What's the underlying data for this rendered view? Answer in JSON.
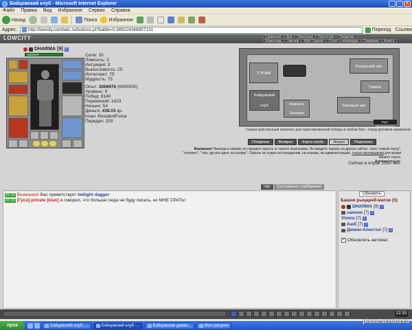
{
  "window": {
    "title": "Бойцовский клуб - Microsoft Internet Explorer"
  },
  "menu": {
    "items": [
      "Файл",
      "Правка",
      "Вид",
      "Избранное",
      "Сервис",
      "Справка"
    ]
  },
  "toolbar": {
    "back_label": "Назад",
    "search_label": "Поиск",
    "favorites_label": "Избранное"
  },
  "address": {
    "label": "Адрес:",
    "url": "http://lowcity.combats.ru/buttons.pl?battle=0.349224348857131",
    "go_label": "Переход",
    "links_label": "Ссылки"
  },
  "game": {
    "logo": "LOWCITY",
    "topnav_row1": [
      "Сражения",
      "Бои",
      "Персонаж",
      "Персонаж",
      "Поединки"
    ],
    "topnav_row2": [
      "Инвентарь",
      "Умения",
      "Мой Серилл",
      "Отчет о переводах",
      "Поединки",
      "Анкета"
    ],
    "character": {
      "name": "DHARMA",
      "level": "[9]",
      "hp": "221/221"
    },
    "stats": {
      "lines": [
        "Сила: 10",
        "Ловкость: 3",
        "Интуиция: 3",
        "Выносливость: 25",
        "Интеллект: 75",
        "Мудрость: 75"
      ]
    },
    "stats2": {
      "exp_label": "Опыт:",
      "exp_value": "3066976",
      "exp_next": "(6000000)",
      "lines": [
        "Уровень: 9",
        "Побед: 8140",
        "Поражений: 1423",
        "Ничьих: 54"
      ],
      "money_label": "Деньги:",
      "money_value": "438.03",
      "money_unit": "кр.",
      "clan": "Клан: ResidentForce",
      "transfers": "Передач: 200"
    },
    "map": {
      "rooms": [
        "3 ЭТАЖ",
        "Рыцарский зал",
        "Комната Знахаря",
        "Бойцовский клуб",
        "Торговый зал",
        "Тамень"
      ],
      "counter": "порт-#0576720521",
      "caption": "Самый действенный комплект для гарантированной победы в любом бою - отряд артников наемников"
    },
    "nav_buttons": [
      "Поединки",
      "Возврат",
      "Карта клуба",
      "Форум",
      "Подсказка"
    ],
    "warning": {
      "bold": "Внимание!",
      "text1": " Никогда и никому не говорите пароль от своего персонажа. Не вводите пароль на других сайтах, типа \"новый город\",",
      "text2": "\"потерял\", \"тем, где все дают на халяву\". Пароль не нужен ни паладинам, ни кланам, ни администрации, ",
      "underline": "только взломщикам",
      "text3": " для кражи",
      "text4": "вашего героя.",
      "signature": "Администрация."
    },
    "online": "Сейчас в клубе 1590 чел."
  },
  "chat": {
    "tabs": [
      "Чат",
      "Системные сообщения"
    ],
    "lines": [
      {
        "time": "22:33",
        "prefix": "Внимание!",
        "text": " Вас приветствует ",
        "name": "twilight dagger"
      },
      {
        "time": "22:33",
        "author": "[Гуси]",
        "private": "private [klan]",
        "text": " я говорил, что больше сюда не буду писать, но МНЕ СРАТЬ!"
      }
    ]
  },
  "room": {
    "refresh_label": "Обновить",
    "title": "Башня рыцарей-магов (5)",
    "users": [
      {
        "name": "DHARMA",
        "level": "[9]"
      },
      {
        "name": "samum",
        "level": "[7]"
      },
      {
        "name": "Vivera",
        "level": "[7]"
      },
      {
        "name": "Аюб",
        "level": "[7]"
      },
      {
        "name": "Демон-Апостол",
        "level": "[7]"
      }
    ],
    "auto_refresh_label": "Обновлять автомат."
  },
  "game_clock": "22:33",
  "taskbar": {
    "start_label": "пуск",
    "tasks": [
      "Бойцовский клуб -...",
      "Бойцовский клуб -...",
      "Бойцовские дневн...",
      "Мои рисунки"
    ]
  },
  "watermark": "photo.scrolls.ru"
}
